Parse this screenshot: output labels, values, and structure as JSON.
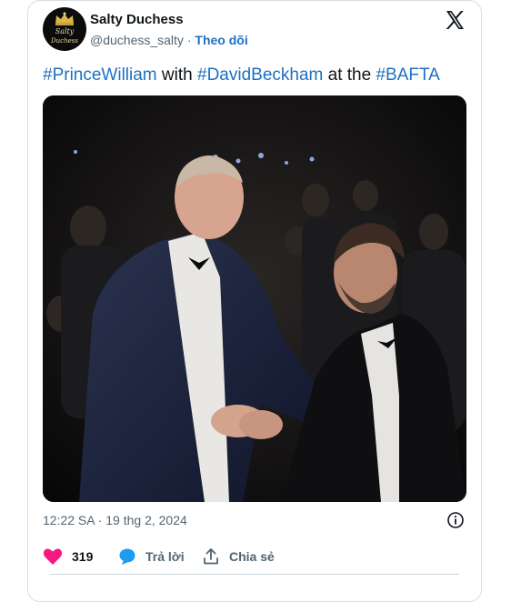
{
  "author": {
    "avatar_text_line1": "Salty",
    "avatar_text_line2": "Duchess",
    "name": "Salty Duchess",
    "handle": "@duchess_salty",
    "separator": "·",
    "follow_label": "Theo dõi"
  },
  "tweet": {
    "parts": [
      {
        "text": "#PrinceWilliam",
        "hashtag": true
      },
      {
        "text": " with ",
        "hashtag": false
      },
      {
        "text": "#DavidBeckham",
        "hashtag": true
      },
      {
        "text": " at the ",
        "hashtag": false
      },
      {
        "text": "#BAFTA",
        "hashtag": true
      }
    ]
  },
  "meta": {
    "timestamp": "12:22 SA · 19 thg 2, 2024"
  },
  "actions": {
    "like_count": "319",
    "reply_label": "Trả lời",
    "share_label": "Chia sẻ"
  },
  "icons": {
    "like": "heart-icon",
    "reply": "speech-bubble-icon",
    "share": "upload-icon",
    "info": "info-icon",
    "brand": "x-logo-icon",
    "avatar_crown": "crown-icon"
  },
  "colors": {
    "hashtag": "#1d70c4",
    "heart": "#f91880",
    "reply_bubble": "#1d9bf0",
    "secondary_text": "#536471"
  }
}
